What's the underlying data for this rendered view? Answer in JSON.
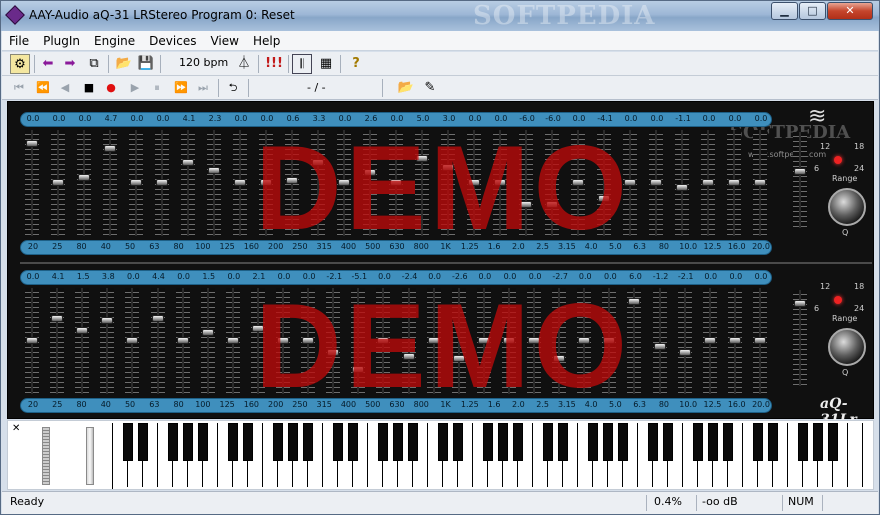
{
  "window": {
    "title": "AAY-Audio aQ-31 LRStereo Program 0: Reset",
    "watermark": "SOFTPEDIA",
    "min": "▁",
    "max": "□",
    "close": "✕"
  },
  "menu": [
    "File",
    "PlugIn",
    "Engine",
    "Devices",
    "View",
    "Help"
  ],
  "toolbar": {
    "bpm": "120 bpm",
    "marks": "!!!",
    "help": "?",
    "position": "- / -"
  },
  "eq": {
    "top_gains": [
      "0.0",
      "0.0",
      "0.0",
      "4.7",
      "0.0",
      "0.0",
      "4.1",
      "2.3",
      "0.0",
      "0.0",
      "0.6",
      "3.3",
      "0.0",
      "2.6",
      "0.0",
      "5.0",
      "3.0",
      "0.0",
      "0.0",
      "-6.0",
      "-6.0",
      "0.0",
      "-4.1",
      "0.0",
      "0.0",
      "-1.1",
      "0.0",
      "0.0",
      "0.0"
    ],
    "bottom_gains": [
      "0.0",
      "4.1",
      "1.5",
      "3.8",
      "0.0",
      "4.4",
      "0.0",
      "1.5",
      "0.0",
      "2.1",
      "0.0",
      "0.0",
      "-2.1",
      "-5.1",
      "0.0",
      "-2.4",
      "0.0",
      "-2.6",
      "0.0",
      "0.0",
      "0.0",
      "-2.7",
      "0.0",
      "0.0",
      "6.0",
      "-1.2",
      "-2.1",
      "0.0",
      "0.0",
      "0.0"
    ],
    "freqs": [
      "20",
      "25",
      "80",
      "40",
      "50",
      "63",
      "80",
      "100",
      "125",
      "160",
      "200",
      "250",
      "315",
      "400",
      "500",
      "630",
      "800",
      "1K",
      "1.25",
      "1.6",
      "2.0",
      "2.5",
      "3.15",
      "4.0",
      "5.0",
      "6.3",
      "80",
      "10.0",
      "12.5",
      "16.0",
      "20.0"
    ],
    "demo_text": "DEMO",
    "range_label": "Range",
    "range_values": [
      "12",
      "18",
      "6",
      "24"
    ],
    "q_label": "Q",
    "brand": "aQ-31Lr",
    "watermark": "SOFTPEDIA",
    "url": "www.softpedia.com",
    "top_levels": [
      0.1,
      0.5,
      0.45,
      0.15,
      0.5,
      0.5,
      0.3,
      0.38,
      0.5,
      0.5,
      0.48,
      0.3,
      0.5,
      0.4,
      0.5,
      0.25,
      0.35,
      0.5,
      0.5,
      0.72,
      0.72,
      0.5,
      0.66,
      0.5,
      0.5,
      0.55,
      0.5,
      0.5,
      0.5
    ],
    "bottom_levels": [
      0.5,
      0.28,
      0.4,
      0.3,
      0.5,
      0.28,
      0.5,
      0.42,
      0.5,
      0.38,
      0.5,
      0.5,
      0.62,
      0.8,
      0.5,
      0.66,
      0.5,
      0.68,
      0.5,
      0.5,
      0.5,
      0.68,
      0.5,
      0.5,
      0.1,
      0.56,
      0.62,
      0.5,
      0.5,
      0.5
    ]
  },
  "status": {
    "ready": "Ready",
    "cpu": "0.4%",
    "level": "-oo dB",
    "num": "NUM"
  },
  "colors": {
    "accent": "#3f8fbd",
    "demo": "#be0a0a"
  }
}
